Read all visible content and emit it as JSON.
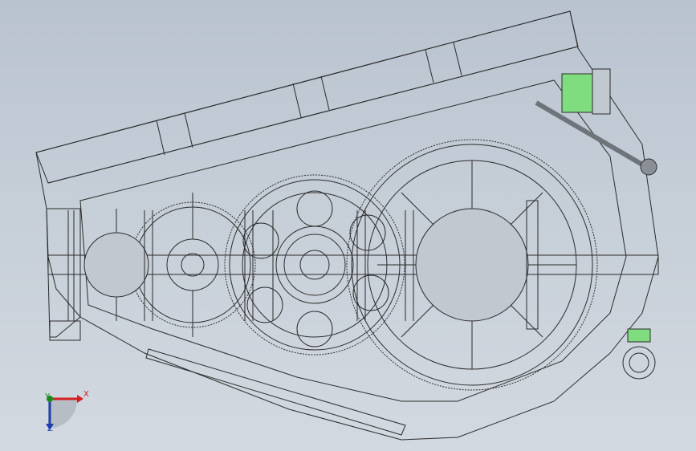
{
  "viewport": {
    "background_top": "#b9c3cf",
    "background_bottom": "#d3d9e0",
    "line_color": "#2b2b2b",
    "highlight_color": "#7fdc7f"
  },
  "model": {
    "type": "gearbox-assembly-section",
    "parts": [
      "housing",
      "input-shaft",
      "intermediate-gear-1",
      "intermediate-gear-2",
      "output-gear",
      "drain-plug-bolt",
      "dipstick",
      "lifting-eye",
      "breather"
    ]
  },
  "triad": {
    "x_label": "X",
    "y_label": "Y",
    "z_label": "Z",
    "x_color": "#d42020",
    "y_color": "#1a8a1a",
    "z_color": "#1f3fb0"
  }
}
